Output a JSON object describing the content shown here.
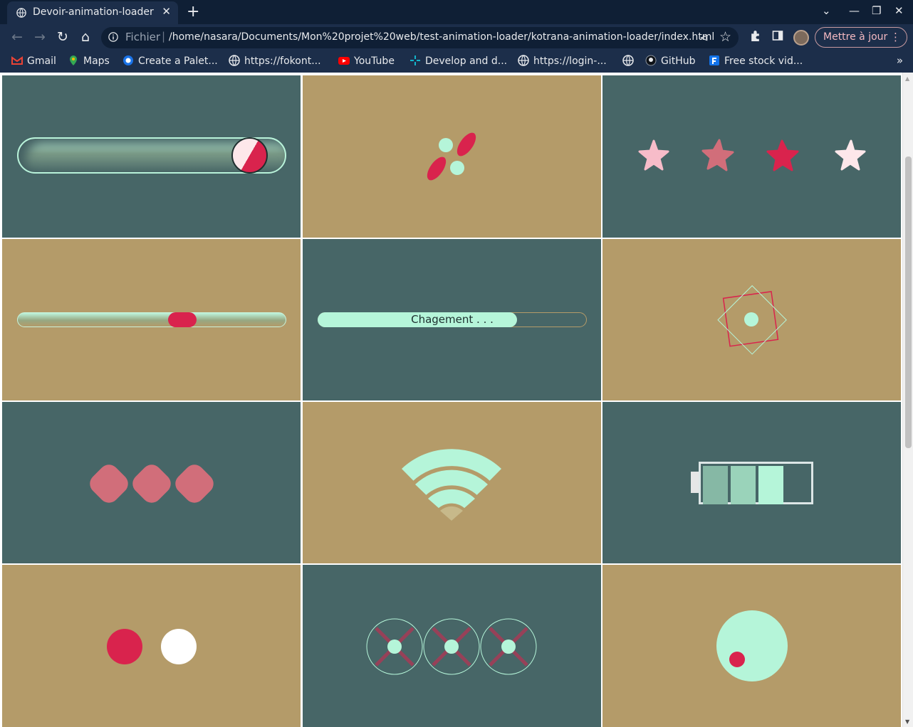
{
  "browser": {
    "tab_title": "Devoir-animation-loader",
    "tab_close": "✕",
    "new_tab": "+",
    "url_scheme": "Fichier",
    "url": "/home/nasara/Documents/Mon%20projet%20web/test-animation-loader/kotrana-animation-loader/index.html",
    "update_button": "Mettre à jour",
    "bookmarks": [
      {
        "label": "Gmail",
        "icon": "gmail-icon"
      },
      {
        "label": "Maps",
        "icon": "maps-icon"
      },
      {
        "label": "Create a Palet...",
        "icon": "globe-icon"
      },
      {
        "label": "https://fokont...",
        "icon": "globe-icon"
      },
      {
        "label": "YouTube",
        "icon": "youtube-icon"
      },
      {
        "label": "Develop and d...",
        "icon": "sparkle-icon"
      },
      {
        "label": "https://login-...",
        "icon": "globe-icon"
      },
      {
        "label": "",
        "icon": "globe-icon"
      },
      {
        "label": "GitHub",
        "icon": "github-icon"
      },
      {
        "label": "Free stock vid...",
        "icon": "freepik-icon"
      }
    ]
  },
  "colors": {
    "teal": "#476667",
    "tan": "#b49b69",
    "mint": "#b5f5d9",
    "crimson": "#d9234d",
    "pink": "#f7bcc9",
    "rose": "#d16e7a"
  },
  "loaders": {
    "progress_text": "Chagement . . .",
    "progress_fraction": 0.74,
    "battery_segments_filled": 3,
    "battery_segments_total": 4
  }
}
